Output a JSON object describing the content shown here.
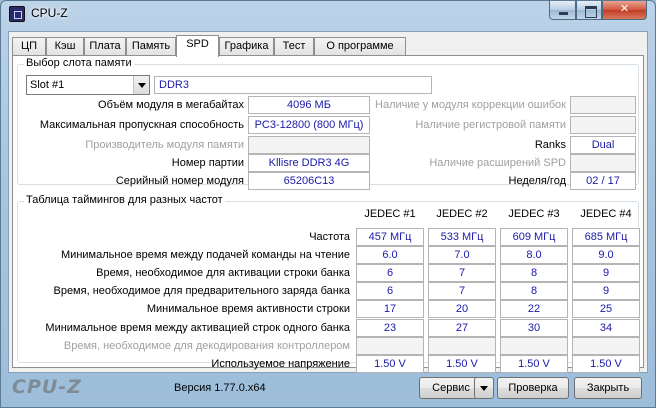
{
  "window": {
    "title": "CPU-Z"
  },
  "tabs": [
    {
      "label": "ЦП"
    },
    {
      "label": "Кэш"
    },
    {
      "label": "Плата"
    },
    {
      "label": "Память"
    },
    {
      "label": "SPD"
    },
    {
      "label": "Графика"
    },
    {
      "label": "Тест"
    },
    {
      "label": "О программе"
    }
  ],
  "active_tab": "SPD",
  "slot_group": {
    "title": "Выбор слота памяти",
    "slot_selected": "Slot #1",
    "memory_type": "DDR3",
    "left_fields": [
      {
        "label": "Объём модуля в мегабайтах",
        "value": "4096 МБ",
        "enabled": true
      },
      {
        "label": "Максимальная пропускная способность",
        "value": "PC3-12800 (800 МГц)",
        "enabled": true
      },
      {
        "label": "Производитель модуля памяти",
        "value": "",
        "enabled": false
      },
      {
        "label": "Номер партии",
        "value": "Kllisre DDR3 4G",
        "enabled": true
      },
      {
        "label": "Серийный номер модуля",
        "value": "65206C13",
        "enabled": true
      }
    ],
    "right_fields": [
      {
        "label": "Наличие у модуля коррекции ошибок",
        "value": "",
        "enabled": false
      },
      {
        "label": "Наличие регистровой памяти",
        "value": "",
        "enabled": false
      },
      {
        "label": "Ranks",
        "value": "Dual",
        "enabled": true
      },
      {
        "label": "Наличие расширений SPD",
        "value": "",
        "enabled": false
      },
      {
        "label": "Неделя/год",
        "value": "02 / 17",
        "enabled": true
      }
    ]
  },
  "timings_group": {
    "title": "Таблица таймингов для разных частот",
    "columns": [
      "JEDEC #1",
      "JEDEC #2",
      "JEDEC #3",
      "JEDEC #4"
    ],
    "rows": [
      {
        "label": "Частота",
        "enabled": true,
        "values": [
          "457 МГц",
          "533 МГц",
          "609 МГц",
          "685 МГц"
        ]
      },
      {
        "label": "Минимальное время между подачей команды на чтение",
        "enabled": true,
        "values": [
          "6.0",
          "7.0",
          "8.0",
          "9.0"
        ]
      },
      {
        "label": "Время, необходимое для активации строки банка",
        "enabled": true,
        "values": [
          "6",
          "7",
          "8",
          "9"
        ]
      },
      {
        "label": "Время, необходимое для предварительного заряда банка",
        "enabled": true,
        "values": [
          "6",
          "7",
          "8",
          "9"
        ]
      },
      {
        "label": "Минимальное время активности строки",
        "enabled": true,
        "values": [
          "17",
          "20",
          "22",
          "25"
        ]
      },
      {
        "label": "Минимальное время между активацией строк одного банка",
        "enabled": true,
        "values": [
          "23",
          "27",
          "30",
          "34"
        ]
      },
      {
        "label": "Время, необходимое для декодирования контроллером",
        "enabled": false,
        "values": [
          "",
          "",
          "",
          ""
        ]
      },
      {
        "label": "Используемое напряжение",
        "enabled": true,
        "values": [
          "1.50 V",
          "1.50 V",
          "1.50 V",
          "1.50 V"
        ]
      }
    ]
  },
  "footer": {
    "brand": "CPU-Z",
    "version": "Версия 1.77.0.x64",
    "tools_label": "Сервис",
    "validate_label": "Проверка",
    "close_label": "Закрыть"
  },
  "colors": {
    "value_text": "#1a1aa8",
    "disabled_text": "#a0a0a0"
  }
}
